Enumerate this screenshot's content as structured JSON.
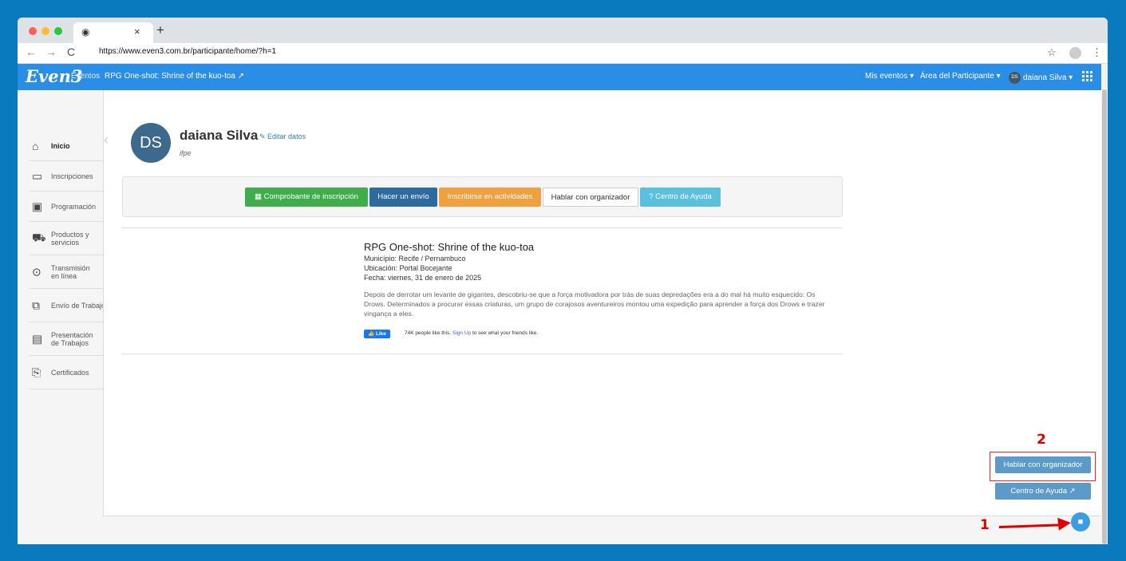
{
  "browser": {
    "url": "https://www.even3.com.br/participante/home/?h=1",
    "new_tab_label": "+",
    "close_label": "×",
    "back": "←",
    "forward": "→",
    "reload": "C",
    "star": "☆",
    "menu": "⋮"
  },
  "navbar": {
    "logo": "Even3",
    "eventos": "Eventos",
    "event_name": "RPG One-shot: Shrine of the kuo-toa ↗",
    "mis_eventos": "Mis eventos ▾",
    "area": "Área del Participante ▾",
    "user_initials": "DS",
    "user": "daiana Silva ▾"
  },
  "sidebar": {
    "items": [
      {
        "label": "Inicio",
        "icon": "home-icon"
      },
      {
        "label": "Inscripciones",
        "icon": "ticket-icon"
      },
      {
        "label": "Programación",
        "icon": "calendar-icon"
      },
      {
        "label": "Productos y servicios",
        "icon": "cart-icon"
      },
      {
        "label": "Transmisión en línea",
        "icon": "play-icon"
      },
      {
        "label": "Envío de Trabajo",
        "icon": "document-copy-icon"
      },
      {
        "label": "Presentación de Trabajos",
        "icon": "presentation-icon"
      },
      {
        "label": "Certificados",
        "icon": "certificate-icon"
      }
    ]
  },
  "profile": {
    "initials": "DS",
    "name": "daiana Silva",
    "edit_label": "✎ Editar datos",
    "institution": "ifpe"
  },
  "buttons": {
    "comprobante": "▦ Comprobante de inscripción",
    "envio": "Hacer un envío",
    "actividades": "Inscribirse en actividades",
    "hablar": "Hablar con organizador",
    "ayuda": "? Centro de Ayuda"
  },
  "event": {
    "title": "RPG One-shot: Shrine of the kuo-toa",
    "municipio": "Município: Recife / Pernambuco",
    "ubicacion": "Ubicación: Portal Bocejante",
    "fecha": "Fecha: viernes, 31 de enero de 2025",
    "description": "Depois de derrotar um levante de gigantes, descobriu-se que a força motivadora por trás de suas depredações era a do mal há muito esquecido: Os Drows. Determinados a procurar essas criaturas, um grupo de corajosos aventureiros montou uma expedição para aprender a força dos Drows e trazer vingança a eles."
  },
  "facebook": {
    "like_label": "👍 Like",
    "count_text": "74K people like this.",
    "signup_link": "Sign Up",
    "rest_text": "to see what your friends like."
  },
  "floating": {
    "hablar": "Hablar con organizador",
    "ayuda": "Centro de Ayuda ↗",
    "chat_icon": "chat-bubble-icon"
  },
  "annotations": {
    "marker1": "1",
    "marker2": "2"
  },
  "colors": {
    "navbar": "#2a8ee6",
    "green": "#3fae4a",
    "dark_blue": "#2d6aa0",
    "orange": "#f0a03e",
    "light_blue": "#5bc0de",
    "annotation_red": "#e10000"
  }
}
